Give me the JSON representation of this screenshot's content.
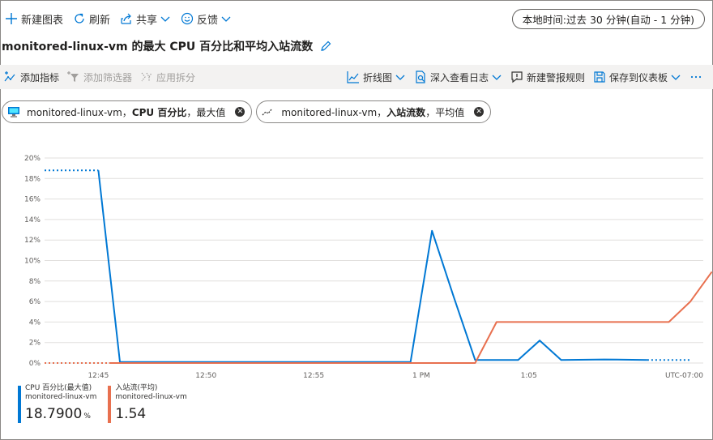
{
  "colors": {
    "accent": "#0078d4",
    "cpu": "#0078d4",
    "net": "#e8704f",
    "grid": "#e1dfdd"
  },
  "cmdbar": {
    "new_chart": "新建图表",
    "refresh": "刷新",
    "share": "共享",
    "feedback": "反馈",
    "time_range": "本地时间:过去 30 分钟(自动 - 1 分钟)"
  },
  "title": "monitored-linux-vm 的最大 CPU 百分比和平均入站流数",
  "toolbar": {
    "add_metric": "添加指标",
    "add_filter": "添加筛选器",
    "apply_split": "应用拆分",
    "line_chart": "折线图",
    "drill_logs": "深入查看日志",
    "new_alert": "新建警报规则",
    "save_dashboard": "保存到仪表板"
  },
  "pills": [
    {
      "resource": "monitored-linux-vm，",
      "metric": "CPU 百分比",
      "agg": "，最大值"
    },
    {
      "resource": "monitored-linux-vm，",
      "metric": "入站流数",
      "agg": "，平均值"
    }
  ],
  "chart_data": {
    "type": "line",
    "y_ticks": [
      "20%",
      "18%",
      "16%",
      "14%",
      "12%",
      "10%",
      "8%",
      "6%",
      "4%",
      "2%",
      "0%"
    ],
    "ylim": [
      0,
      20
    ],
    "x_ticks": [
      {
        "label": "12:45",
        "t": 2.5
      },
      {
        "label": "12:50",
        "t": 7.5
      },
      {
        "label": "12:55",
        "t": 12.5
      },
      {
        "label": "1 PM",
        "t": 17.5
      },
      {
        "label": "1:05",
        "t": 22.5
      }
    ],
    "xlim": [
      0,
      30
    ],
    "timezone": "UTC-07:00",
    "grid": true,
    "series": [
      {
        "name": "CPU 百分比(最大值)",
        "color": "#0078d4",
        "dotted_start": [
          [
            0,
            18.8
          ],
          [
            2.5,
            18.8
          ]
        ],
        "points": [
          [
            2.5,
            18.8
          ],
          [
            3.5,
            0.1
          ],
          [
            17.0,
            0.1
          ],
          [
            18.0,
            12.9
          ],
          [
            19.0,
            6.5
          ],
          [
            20.0,
            0.3
          ],
          [
            22.0,
            0.3
          ],
          [
            23.0,
            2.2
          ],
          [
            24.0,
            0.3
          ],
          [
            26.0,
            0.35
          ],
          [
            28.0,
            0.3
          ]
        ],
        "dotted_end": [
          [
            28.0,
            0.3
          ],
          [
            30.0,
            0.3
          ]
        ]
      },
      {
        "name": "入站流(平均)",
        "color": "#e8704f",
        "dotted_start": [
          [
            0,
            0
          ],
          [
            3.0,
            0
          ]
        ],
        "points": [
          [
            3.0,
            0
          ],
          [
            20.0,
            0
          ],
          [
            21.0,
            4.0
          ],
          [
            29.0,
            4.0
          ],
          [
            30.0,
            6.0
          ],
          [
            31.0,
            8.9
          ]
        ],
        "dotted_end": []
      }
    ]
  },
  "legend": [
    {
      "name": "CPU 百分比(最大值)",
      "resource": "monitored-linux-vm",
      "value": "18.7900",
      "unit": "%",
      "color": "#0078d4"
    },
    {
      "name": "入站流(平均)",
      "resource": "monitored-linux-vm",
      "value": "1.54",
      "unit": "",
      "color": "#e8704f"
    }
  ]
}
